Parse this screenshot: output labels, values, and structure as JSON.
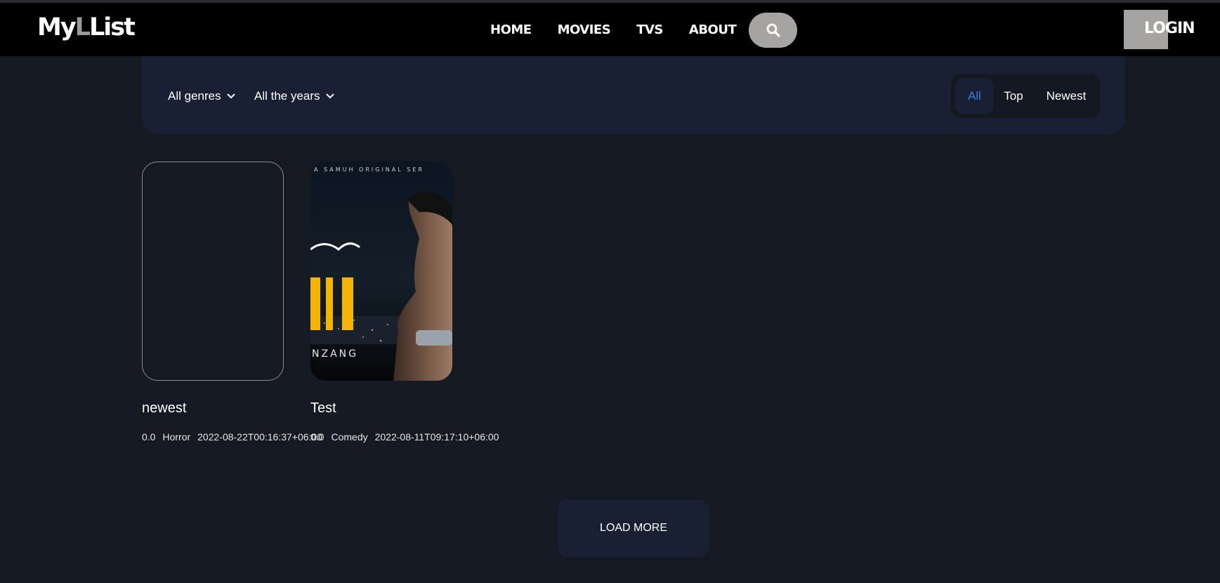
{
  "brand": {
    "logo_part1": "My",
    "logo_accent": "L",
    "logo_part2": "List"
  },
  "nav": {
    "home": "HOME",
    "movies": "MOVIES",
    "tvs": "TVS",
    "about": "ABOUT"
  },
  "header": {
    "login_label": "LOGIN",
    "search_icon": "search-icon"
  },
  "filters": {
    "genres_label": "All genres",
    "years_label": "All the years",
    "tabs": [
      "All",
      "Top",
      "Newest"
    ],
    "active_tab": "All"
  },
  "cards": [
    {
      "title": "newest",
      "rating": "0.0",
      "genre": "Horror",
      "date": "2022-08-22T00:16:37+06:00"
    },
    {
      "title": "Test",
      "rating": "0.0",
      "genre": "Comedy",
      "date": "2022-08-11T09:17:10+06:00",
      "poster_text_top": "A SAMUH ORIGINAL SER",
      "poster_text_bottom": "NZANG"
    }
  ],
  "load_more_label": "LOAD MORE",
  "colors": {
    "accent": "#3e7bd8",
    "panel": "#192033",
    "background": "#151922",
    "search_bg": "#a8a3a3"
  }
}
